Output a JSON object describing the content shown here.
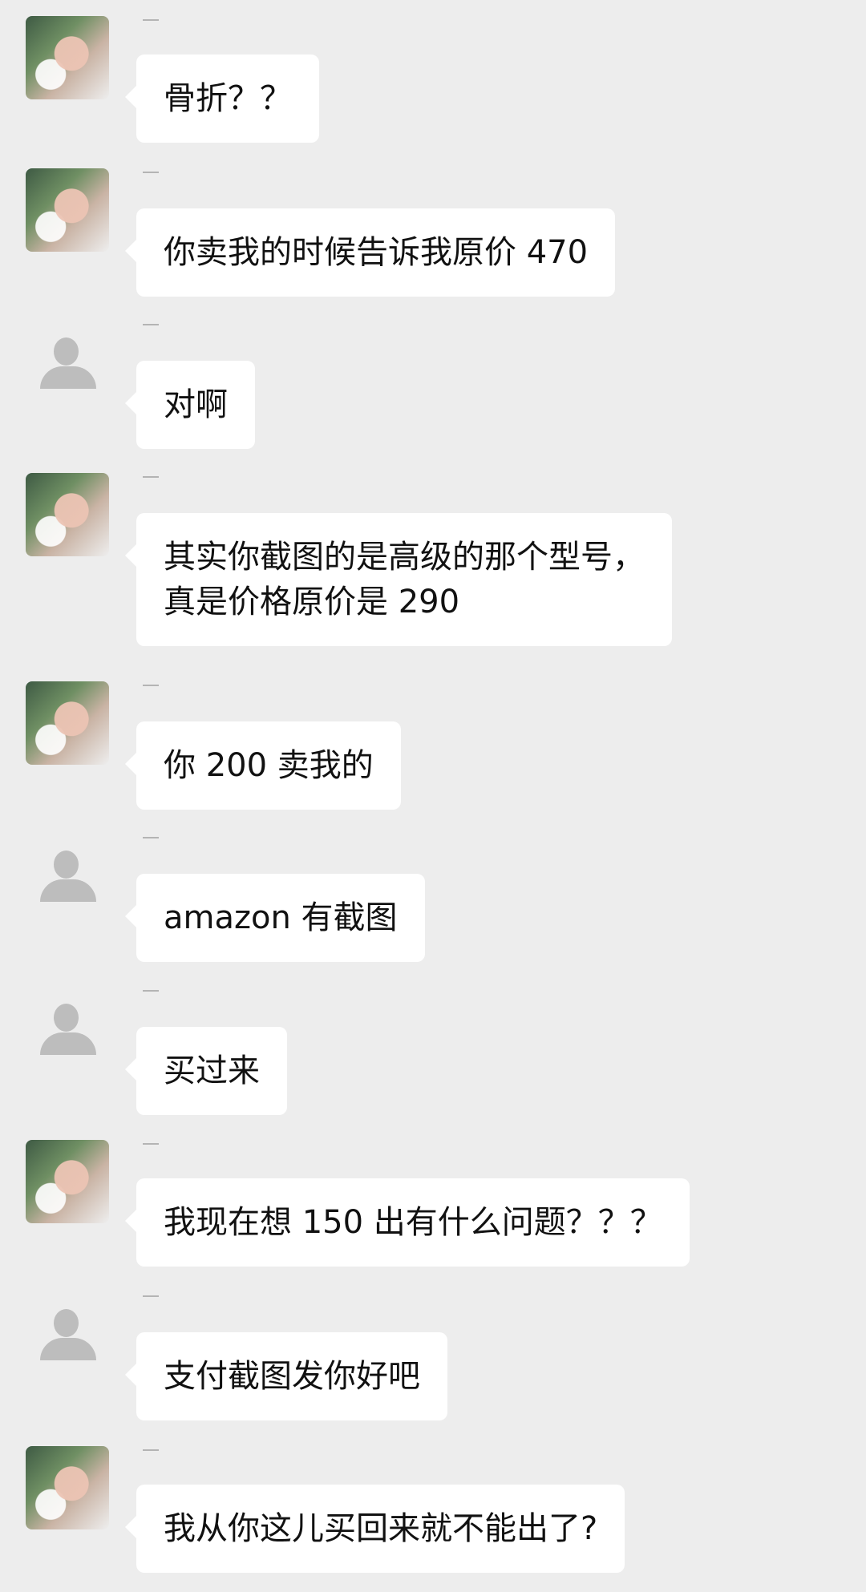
{
  "messages": [
    {
      "avatar": "photo",
      "text": "骨折？？"
    },
    {
      "avatar": "photo",
      "text": "你卖我的时候告诉我原价 470"
    },
    {
      "avatar": "default",
      "text": "对啊"
    },
    {
      "avatar": "photo",
      "text": "其实你截图的是高级的那个型号，\n真是价格原价是 290"
    },
    {
      "avatar": "photo",
      "text": "你 200 卖我的"
    },
    {
      "avatar": "default",
      "text": "amazon 有截图"
    },
    {
      "avatar": "default",
      "text": "买过来"
    },
    {
      "avatar": "photo",
      "text": "我现在想 150 出有什么问题？？？"
    },
    {
      "avatar": "default",
      "text": "支付截图发你好吧"
    },
    {
      "avatar": "photo",
      "text": "我从你这儿买回来就不能出了?"
    }
  ]
}
